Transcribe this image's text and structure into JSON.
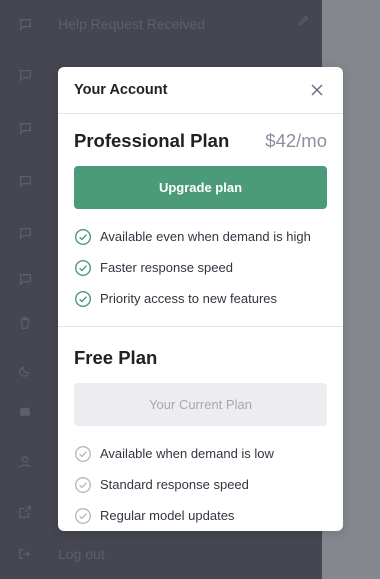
{
  "sidebar": {
    "items": [
      {
        "label": "Help Request Received",
        "icon": "chat-bubble-icon"
      },
      {
        "label": "",
        "icon": "chat-bubble-icon"
      },
      {
        "label": "",
        "icon": "chat-bubble-icon"
      },
      {
        "label": "",
        "icon": "chat-bubble-icon"
      },
      {
        "label": "",
        "icon": "chat-bubble-icon"
      },
      {
        "label": "",
        "icon": "chat-bubble-icon"
      },
      {
        "label": "",
        "icon": "trash-icon"
      },
      {
        "label": "",
        "icon": "moon-icon"
      },
      {
        "label": "",
        "icon": "discord-icon"
      },
      {
        "label": "",
        "icon": "user-icon"
      },
      {
        "label": "",
        "icon": "external-link-icon"
      },
      {
        "label": "Log out",
        "icon": "logout-icon"
      }
    ]
  },
  "modal": {
    "title": "Your Account",
    "pro": {
      "name": "Professional Plan",
      "price": "$42/mo",
      "button": "Upgrade plan",
      "features": [
        "Available even when demand is high",
        "Faster response speed",
        "Priority access to new features"
      ],
      "check_color": "#4b9a79"
    },
    "free": {
      "name": "Free Plan",
      "button": "Your Current Plan",
      "features": [
        "Available when demand is low",
        "Standard response speed",
        "Regular model updates"
      ],
      "check_color": "#b4b4be"
    }
  },
  "colors": {
    "accent": "#4b9a79",
    "overlay": "#8a8c93"
  }
}
